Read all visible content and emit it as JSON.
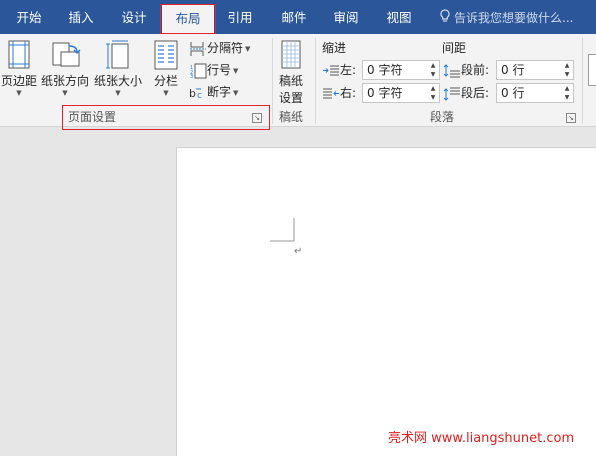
{
  "tabs": [
    {
      "label": "开始",
      "active": false
    },
    {
      "label": "插入",
      "active": false
    },
    {
      "label": "设计",
      "active": false
    },
    {
      "label": "布局",
      "active": true
    },
    {
      "label": "引用",
      "active": false
    },
    {
      "label": "邮件",
      "active": false
    },
    {
      "label": "审阅",
      "active": false
    },
    {
      "label": "视图",
      "active": false
    }
  ],
  "tell_me": "告诉我您想要做什么...",
  "page_setup": {
    "margins": "页边距",
    "orientation": "纸张方向",
    "size": "纸张大小",
    "columns": "分栏",
    "breaks": "分隔符",
    "line_numbers": "行号",
    "hyphenation": "断字",
    "group_label": "页面设置"
  },
  "manuscript": {
    "button": "稿纸\n设置",
    "button_line1": "稿纸",
    "button_line2": "设置",
    "group_label": "稿纸"
  },
  "paragraph": {
    "indent_title": "缩进",
    "spacing_title": "间距",
    "left_label": "左:",
    "right_label": "右:",
    "before_label": "段前:",
    "after_label": "段后:",
    "left_value": "0 字符",
    "right_value": "0 字符",
    "before_value": "0 行",
    "after_value": "0 行",
    "group_label": "段落"
  },
  "document": {
    "paragraph_mark": "↵"
  },
  "watermark": "亮术网 www.liangshunet.com",
  "colors": {
    "tabbar": "#2b579a",
    "ribbon": "#f3f3f3",
    "highlight": "#e0242c",
    "canvas": "#e6e6e6"
  }
}
